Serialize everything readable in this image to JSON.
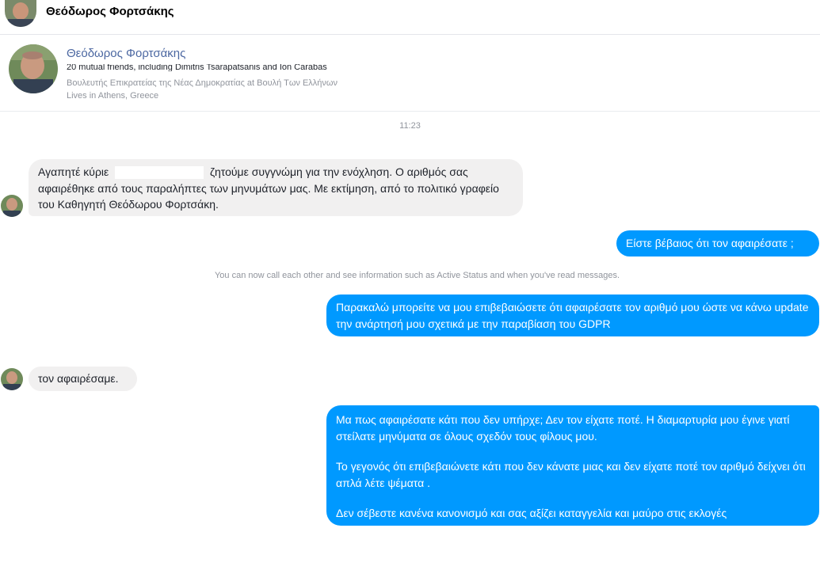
{
  "header": {
    "contact_name": "Θεόδωρος Φορτσάκης"
  },
  "profile": {
    "name": "Θεόδωρος Φορτσάκης",
    "mutual_friends": "20 mutual friends, including Dimitris Tsarapatsanis and Ion Carabas",
    "job": "Βουλευτής Επικρατείας της Νέας Δημοκρατίας at Βουλή Των Ελλήνων",
    "location": "Lives in Athens, Greece"
  },
  "conversation": {
    "timestamp": "11:23",
    "notice": "You can now call each other and see information such as Active Status and when you've read messages.",
    "messages": [
      {
        "direction": "incoming",
        "text_before_redaction": "Αγαπητέ κύριε",
        "text_after_redaction": "ζητούμε συγγνώμη για την ενόχληση. Ο αριθμός σας αφαιρέθηκε από τους παραλήπτες των μηνυμάτων μας. Με εκτίμηση, από το πολιτικό γραφείο του Καθηγητή Θεόδωρου Φορτσάκη."
      },
      {
        "direction": "outgoing",
        "text": "Είστε βέβαιος ότι τον αφαιρέσατε ;"
      },
      {
        "direction": "outgoing",
        "text": "Παρακαλώ μπορείτε να μου επιβεβαιώσετε ότι αφαιρέσατε τον αριθμό μου ώστε να κάνω update την ανάρτησή μου σχετικά με την παραβίαση του GDPR"
      },
      {
        "direction": "incoming",
        "text": "τον αφαιρέσαμε."
      },
      {
        "direction": "outgoing",
        "paragraphs": [
          "Μα πως αφαιρέσατε κάτι που δεν υπήρχε; Δεν  τον είχατε ποτέ. Η διαμαρτυρία μου έγινε γιατί στείλατε μηνύματα σε όλους σχεδόν τους φίλους μου.",
          "Το γεγονός ότι επιβεβαιώνετε κάτι που δεν κάνατε μιας και δεν είχατε ποτέ τον αριθμό δείχνει ότι απλά λέτε ψέματα .",
          "Δεν σέβεστε κανένα κανονισμό και σας αξίζει καταγγελία και μαύρο στις εκλογές"
        ]
      }
    ]
  },
  "colors": {
    "outgoing_bubble": "#0099ff",
    "incoming_bubble": "#f1f0f0",
    "profile_name": "#4b67a1",
    "meta_text": "#90949c"
  },
  "icons": [
    "contact-avatar-icon"
  ]
}
